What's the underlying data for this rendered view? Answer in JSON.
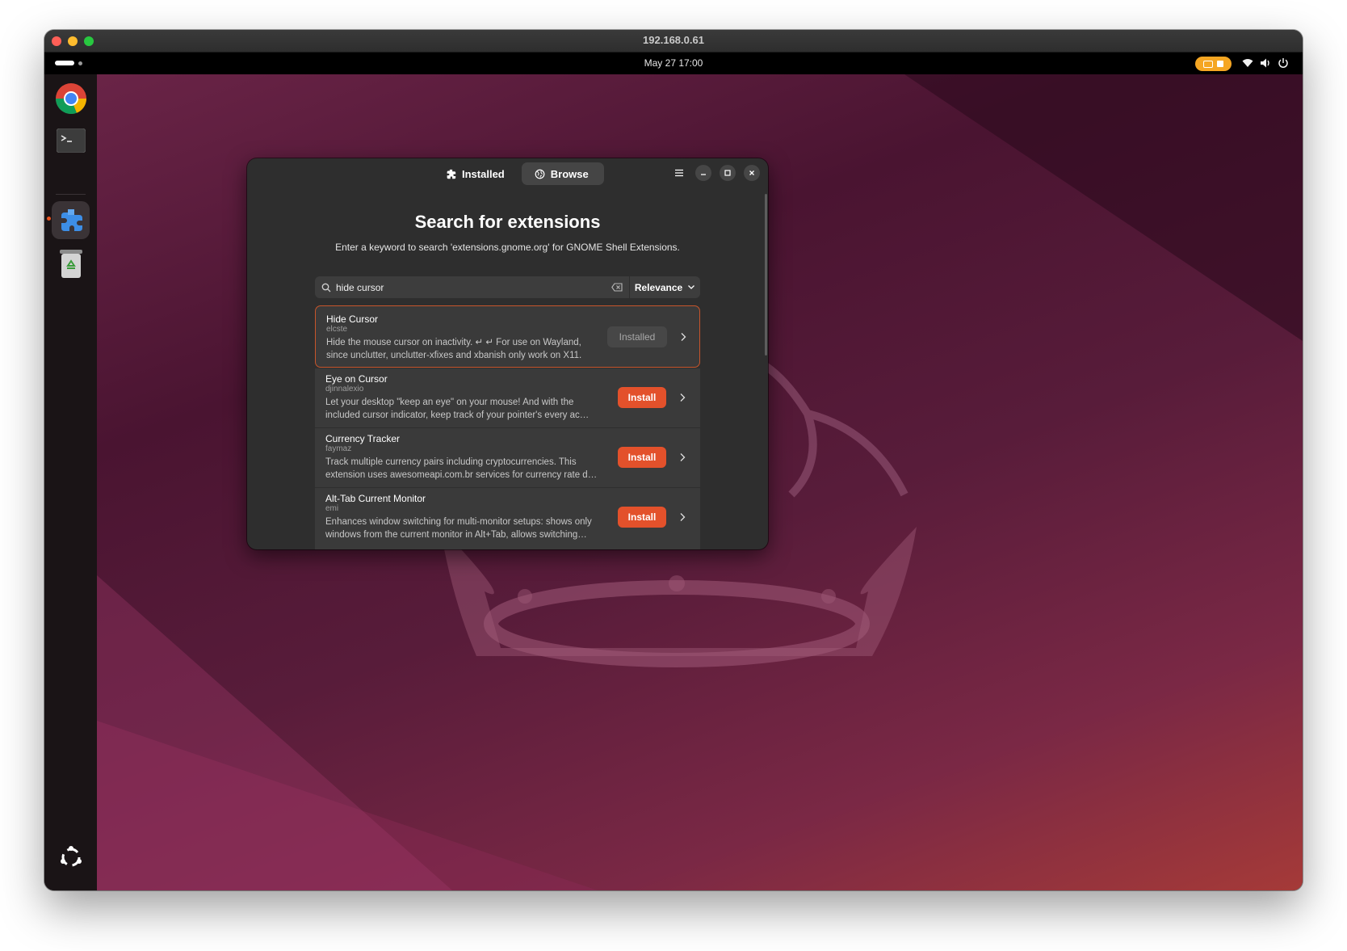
{
  "mac_window": {
    "title": "192.168.0.61"
  },
  "topbar": {
    "clock": "May 27  17:00"
  },
  "dock": {
    "items": [
      {
        "name": "Google Chrome",
        "icon": "chrome-icon"
      },
      {
        "name": "Terminal",
        "icon": "terminal-icon"
      },
      {
        "name": "Extension Manager",
        "icon": "puzzle-icon"
      },
      {
        "name": "Trash",
        "icon": "trash-icon"
      }
    ],
    "show_apps_icon": "ubuntu-logo-icon"
  },
  "app": {
    "tabs": [
      {
        "label": "Installed",
        "icon": "puzzle-icon",
        "selected": false
      },
      {
        "label": "Browse",
        "icon": "globe-icon",
        "selected": true
      }
    ],
    "title": "Search for extensions",
    "subtitle": "Enter a keyword to search 'extensions.gnome.org' for GNOME Shell Extensions.",
    "search": {
      "value": "hide cursor",
      "placeholder": ""
    },
    "sort": {
      "label": "Relevance"
    },
    "results": [
      {
        "name": "Hide Cursor",
        "author": "elcste",
        "desc_line1": "Hide the mouse cursor on inactivity. ↵ ↵ For use on Wayland,",
        "desc_line2": "since unclutter, unclutter-xfixes and xbanish only work on X11.",
        "action": "Installed"
      },
      {
        "name": "Eye on Cursor",
        "author": "djinnalexio",
        "desc_line1": "Let your desktop \"keep an eye\" on your mouse! And with the",
        "desc_line2": "included cursor indicator, keep track of your pointer's every ac…",
        "action": "Install"
      },
      {
        "name": "Currency Tracker",
        "author": "faymaz",
        "desc_line1": "Track multiple currency pairs including cryptocurrencies. This",
        "desc_line2": "extension uses awesomeapi.com.br services for currency rate d…",
        "action": "Install"
      },
      {
        "name": "Alt-Tab Current Monitor",
        "author": "emi",
        "desc_line1": "Enhances window switching for multi-monitor setups: shows only",
        "desc_line2": "windows from the current monitor in Alt+Tab, allows switching…",
        "action": "Install"
      }
    ]
  },
  "colors": {
    "accent": "#e3512b",
    "selected_border": "#c7552b",
    "window_bg": "#2e2e2e",
    "row_bg": "#3a3a3a",
    "remote_indicator": "#f5a623"
  }
}
